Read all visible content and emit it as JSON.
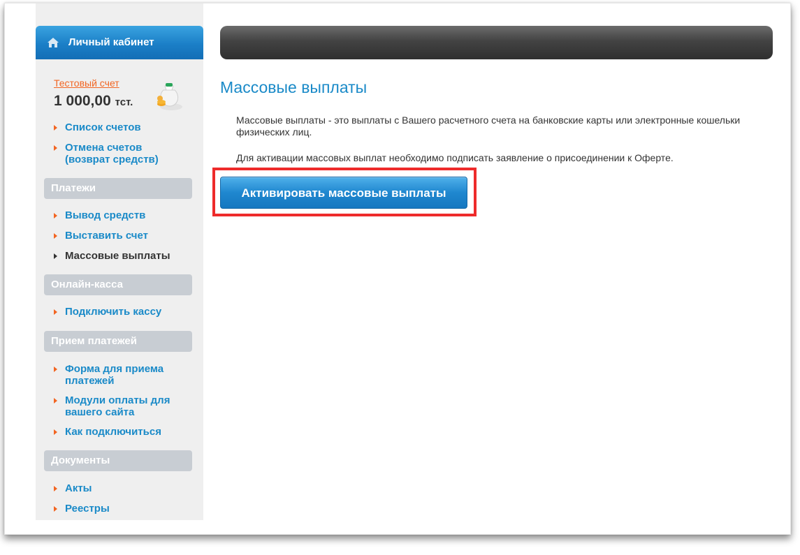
{
  "sidebar": {
    "header_title": "Личный кабинет",
    "account_link": "Тестовый счет",
    "balance_amount": "1 000,00",
    "balance_currency": "тст.",
    "account_items": [
      {
        "label": "Список счетов"
      },
      {
        "label": "Отмена счетов (возврат средств)"
      }
    ],
    "sections": [
      {
        "title": "Платежи",
        "items": [
          {
            "label": "Вывод средств"
          },
          {
            "label": "Выставить счет"
          },
          {
            "label": "Массовые выплаты",
            "active": true
          }
        ]
      },
      {
        "title": "Онлайн-касса",
        "items": [
          {
            "label": "Подключить кассу"
          }
        ]
      },
      {
        "title": "Прием платежей",
        "items": [
          {
            "label": "Форма для приема платежей"
          },
          {
            "label": "Модули оплаты для вашего сайта"
          },
          {
            "label": "Как подключиться"
          }
        ]
      },
      {
        "title": "Документы",
        "items": [
          {
            "label": "Акты"
          },
          {
            "label": "Реестры"
          }
        ]
      }
    ]
  },
  "main": {
    "heading": "Массовые выплаты",
    "description": "Массовые выплаты - это выплаты с Вашего расчетного счета на банковские карты или электронные кошельки физических лиц.",
    "activation_note": "Для активации массовых выплат необходимо подписать заявление о присоединении к Оферте.",
    "activate_button": "Активировать массовые выплаты"
  },
  "colors": {
    "accent_blue": "#1a8ac8",
    "link_orange": "#f26522",
    "highlight_red": "#ee2b2b",
    "section_gray": "#c8cdd3"
  },
  "icons": [
    "home-icon",
    "money-bag-icon",
    "arrow-bullet-icon"
  ]
}
